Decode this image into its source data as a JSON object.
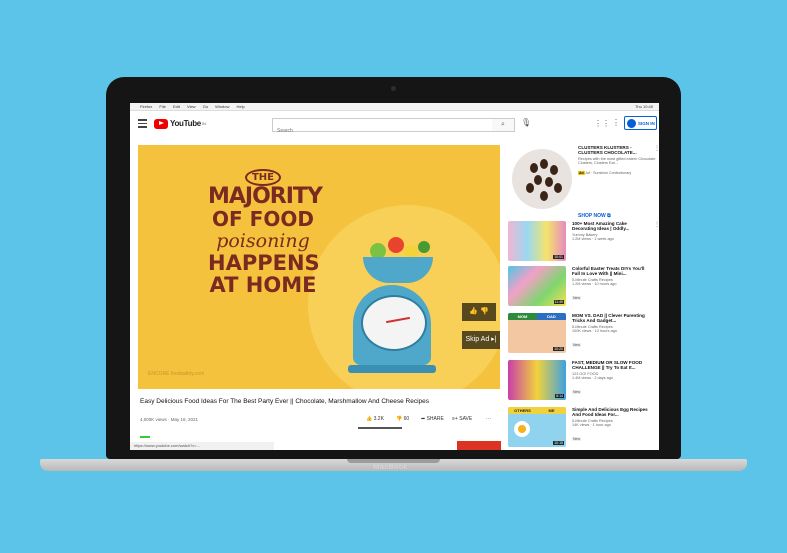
{
  "device": {
    "brand_label": "MacBook"
  },
  "menubar": {
    "items": [
      "Firefox",
      "File",
      "Edit",
      "View",
      "Go",
      "Window",
      "Help"
    ],
    "status": "Thu 10:45"
  },
  "youtube": {
    "logo_text": "YouTube",
    "logo_region": "IN",
    "search_placeholder": "Search",
    "signin_label": "SIGN IN"
  },
  "player": {
    "thumb_headline": {
      "the": "THE",
      "line1": "MAJORITY",
      "line2": "OF FOOD",
      "line3": "poisoning",
      "line4": "HAPPENS",
      "line5": "AT HOME"
    },
    "skip_ad_label": "Skip Ad ▸|",
    "thumbs_label": "👍 👎",
    "watermark": "ENCORE  foodsafety.com"
  },
  "video": {
    "title": "Easy Delicious Food Ideas For The Best Party Ever || Chocolate, Marshmallow And Cheese Recipes",
    "views_date": "4,000K views · May 16, 2021",
    "likes": "3.2K",
    "dislikes": "60",
    "share_label": "SHARE",
    "save_label": "SAVE",
    "more_label": "···",
    "status_url": "https://www.youtube.com/watch?v=..."
  },
  "sidebar": {
    "ad": {
      "title": "CLUSTERS KLUSTERS - CLUSTERS CHOCOLATE...",
      "description": "Recipes with the most gifted eatern Chocolate Clusters, Clusters Eat...",
      "sponsor": "Ad · Sunshine Confectionary",
      "badge": "Ad",
      "shop_now": "SHOP NOW"
    },
    "items": [
      {
        "title": "100+ Most Amazing Cake Decorating Ideas | Oddly...",
        "channel": "Yummy Bakery",
        "meta": "1.2M views · 1 week ago",
        "badge": "",
        "duration": "10:01"
      },
      {
        "title": "Colorful Easter Treats DIYs You'll Fall In Love With || Mini...",
        "channel": "5-Minute Crafts Recipes",
        "meta": "1.2M views · 10 hours ago",
        "badge": "New",
        "duration": "11:49"
      },
      {
        "title": "MOM VS. DAD || Clever Parenting Tricks And Gadget...",
        "channel": "5-Minute Crafts Recipes",
        "meta": "100K views · 12 hours ago",
        "badge": "New",
        "duration": "10:20"
      },
      {
        "title": "FAST, MEDIUM OR SLOW FOOD CHALLENGE || Try To Eat It...",
        "channel": "123 GO! FOOD",
        "meta": "1.4M views · 2 days ago",
        "badge": "New",
        "duration": "8:14"
      },
      {
        "title": "Simple And Delicious Egg Recipes And Food Ideas For...",
        "channel": "5-Minute Crafts Recipes",
        "meta": "14K views · 1 hour ago",
        "badge": "New",
        "duration": "10:15"
      }
    ],
    "thumb_labels": {
      "mom": "MOM",
      "dad": "DAD",
      "others": "OTHERS",
      "me": "ME"
    }
  },
  "colors": {
    "background": "#5bc4e8",
    "thumb_yellow": "#f5c23d",
    "headline_brown": "#7a2a20",
    "scale_blue": "#4fa8c9",
    "youtube_red": "#ee0000",
    "link_blue": "#065fd4"
  }
}
